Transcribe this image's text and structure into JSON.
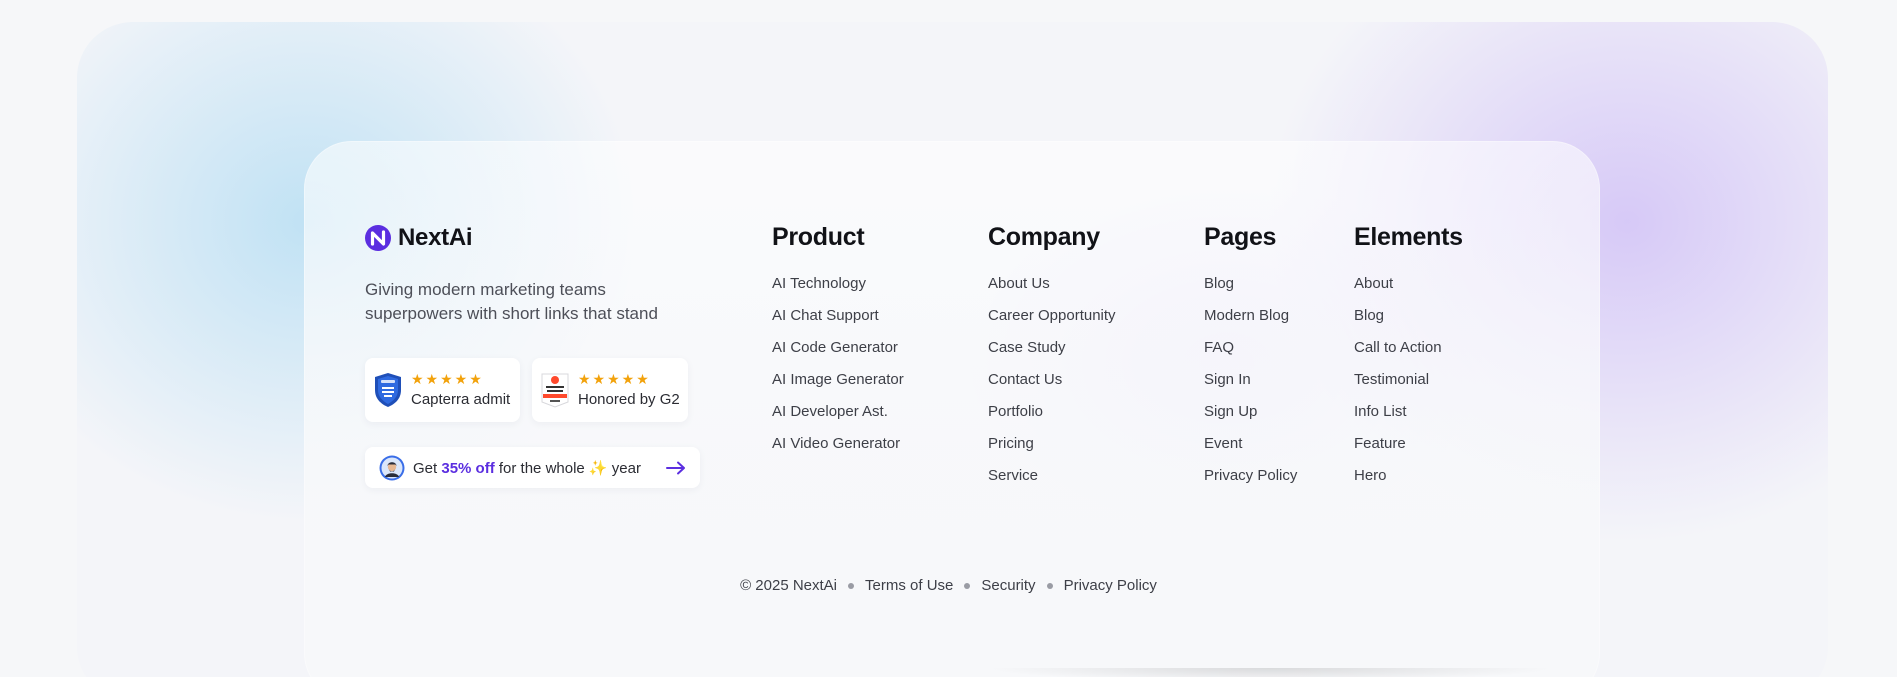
{
  "brand": {
    "name": "NextAi",
    "tagline": "Giving modern marketing teams superpowers with short links that stand",
    "logo_icon": "nextai-logo-icon"
  },
  "badges": [
    {
      "label": "Capterra admit",
      "stars": "★★★★★",
      "icon": "capterra-icon"
    },
    {
      "label": "Honored by G2",
      "stars": "★★★★★",
      "icon": "g2-icon"
    }
  ],
  "promo": {
    "prefix": "Get",
    "highlight": "35% off",
    "suffix": "for the whole ✨ year",
    "icon": "arrow-right-icon",
    "accent": "#5b2ee0"
  },
  "columns": {
    "product": {
      "title": "Product",
      "items": [
        "AI Technology",
        "AI Chat Support",
        "AI Code Generator",
        "AI Image Generator",
        "AI Developer Ast.",
        "AI Video Generator"
      ]
    },
    "company": {
      "title": "Company",
      "items": [
        "About Us",
        "Career Opportunity",
        "Case Study",
        "Contact Us",
        "Portfolio",
        "Pricing",
        "Service"
      ]
    },
    "pages": {
      "title": "Pages",
      "items": [
        "Blog",
        "Modern Blog",
        "FAQ",
        "Sign In",
        "Sign Up",
        "Event",
        "Privacy Policy"
      ]
    },
    "elements": {
      "title": "Elements",
      "items": [
        "About",
        "Blog",
        "Call to Action",
        "Testimonial",
        "Info List",
        "Feature",
        "Hero"
      ]
    }
  },
  "footer": {
    "copyright": "© 2025 NextAi",
    "links": [
      "Terms of Use",
      "Security",
      "Privacy Policy"
    ]
  },
  "colors": {
    "accent": "#5b2ee0",
    "star": "#f2a20c",
    "text": "#1c1d22"
  }
}
